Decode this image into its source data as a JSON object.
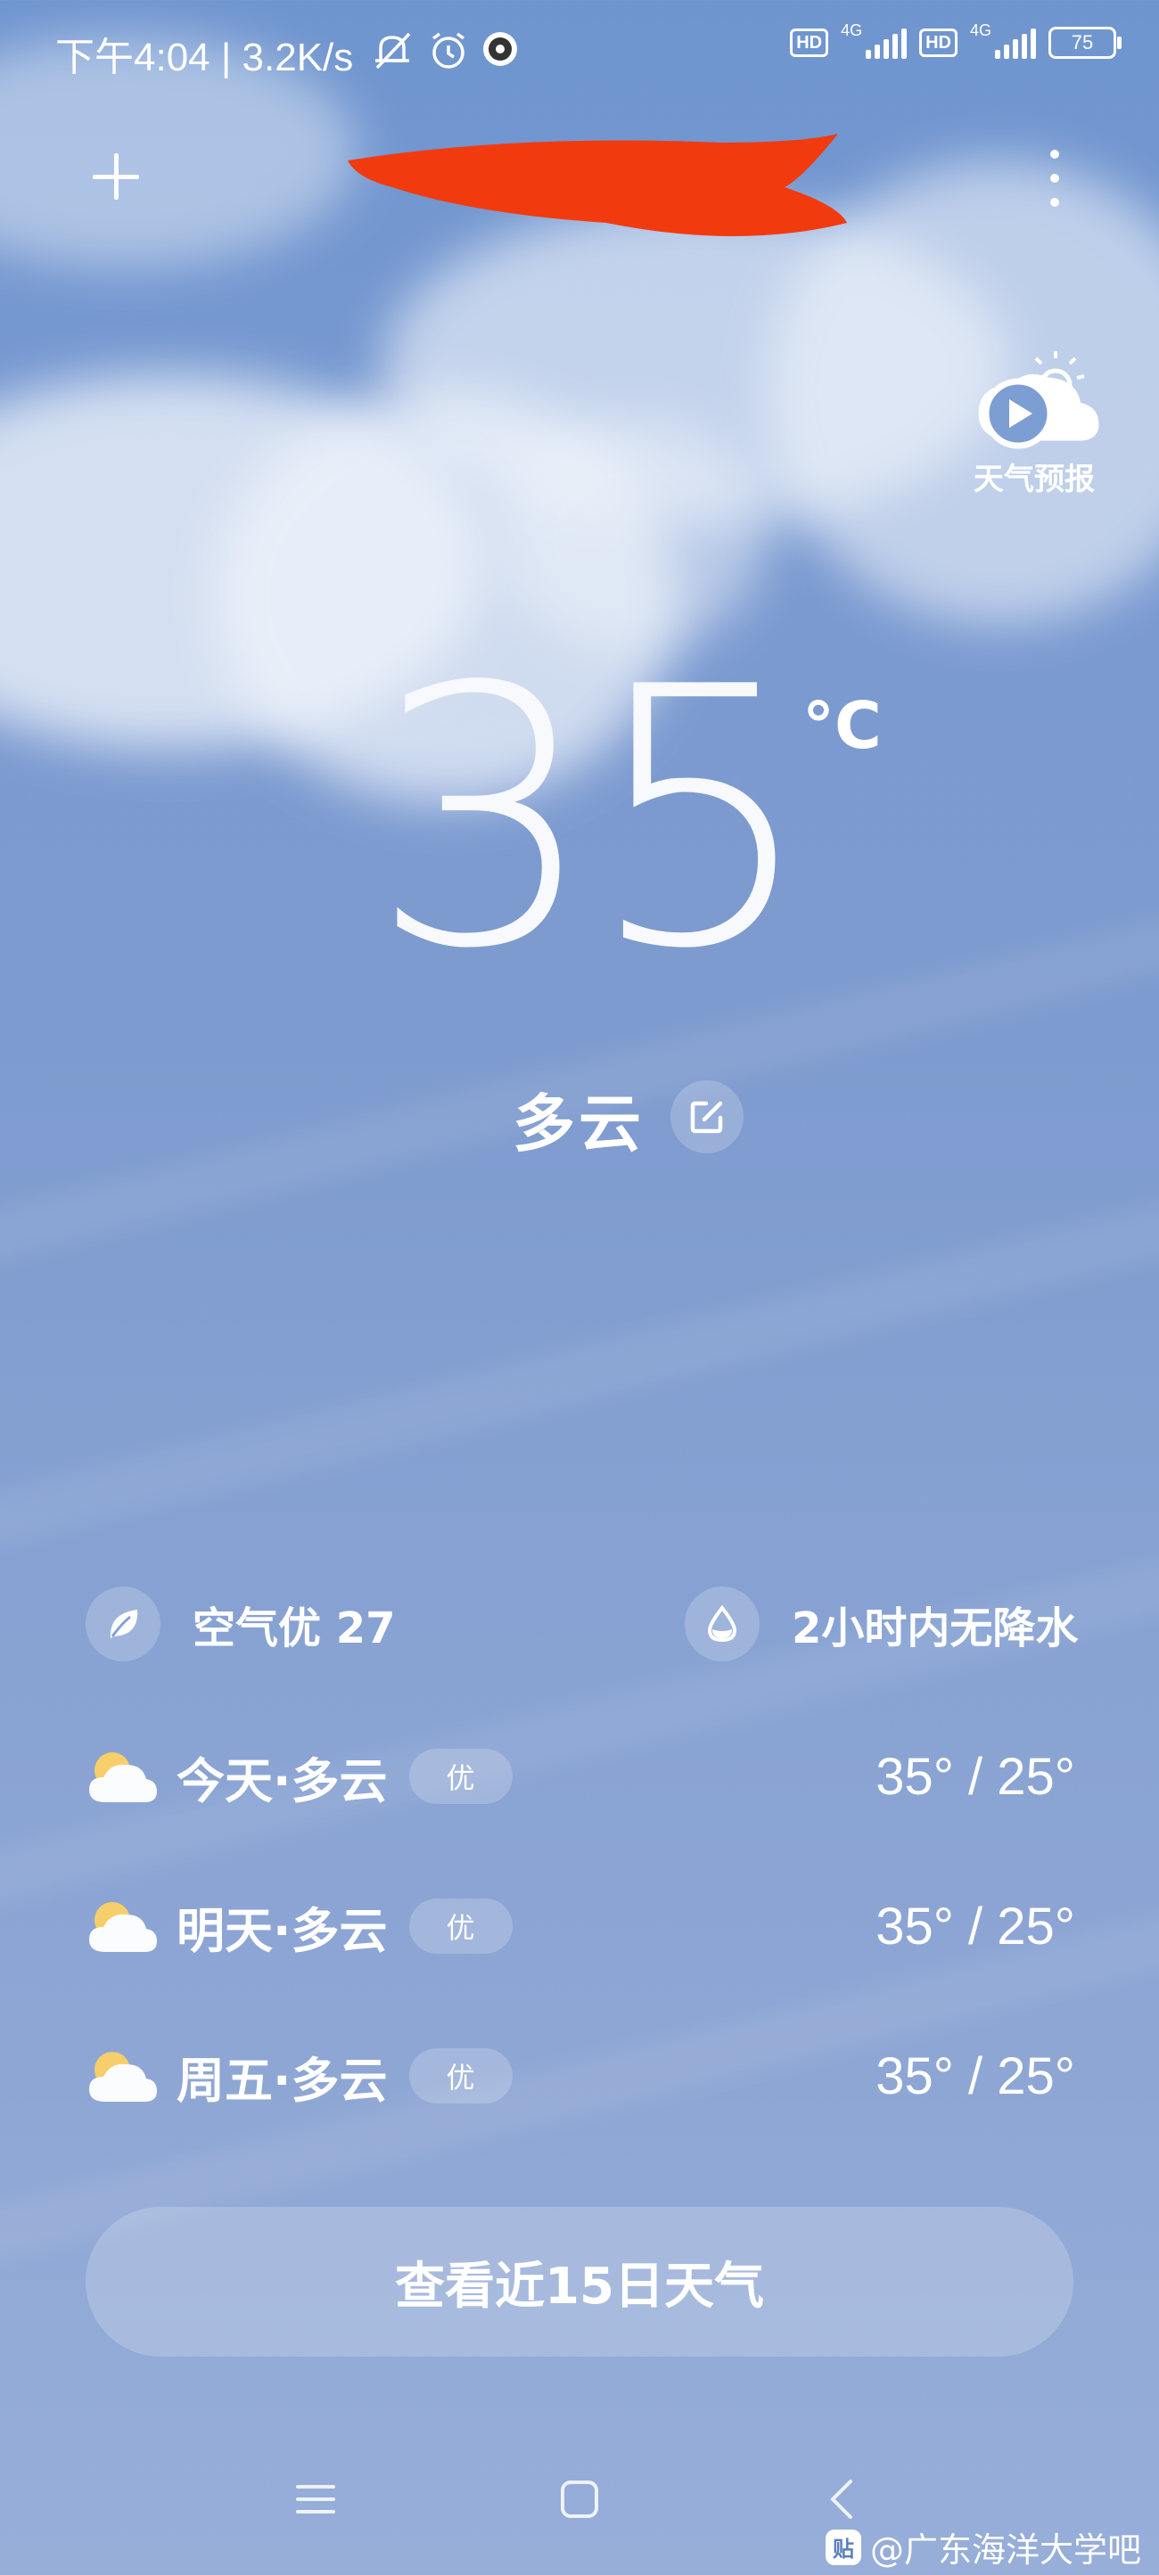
{
  "status_bar": {
    "time": "下午4:04",
    "speed": "3.2K/s",
    "sim1_badge": "HD",
    "sim1_net": "4G",
    "sim2_badge": "HD",
    "sim2_net": "4G",
    "battery": "75"
  },
  "header": {
    "add_icon": "plus-icon",
    "menu_icon": "more-vertical-icon",
    "location_redacted": true
  },
  "forecast_video": {
    "label": "天气预报",
    "icon": "play-cloud-sun-icon"
  },
  "current": {
    "temperature": "35",
    "unit": "°C",
    "condition": "多云"
  },
  "info": {
    "air_quality": "空气优 27",
    "precipitation": "2小时内无降水"
  },
  "daily": [
    {
      "day": "今天·多云",
      "aqi": "优",
      "range": "35° / 25°"
    },
    {
      "day": "明天·多云",
      "aqi": "优",
      "range": "35° / 25°"
    },
    {
      "day": "周五·多云",
      "aqi": "优",
      "range": "35° / 25°"
    }
  ],
  "forecast_15_button": "查看近15日天气",
  "watermark": {
    "logo": "贴",
    "text": "@广东海洋大学吧"
  },
  "colors": {
    "sky_top": "#6f95cf",
    "sky_bottom": "#96aed8",
    "redaction": "#f23a0f"
  }
}
